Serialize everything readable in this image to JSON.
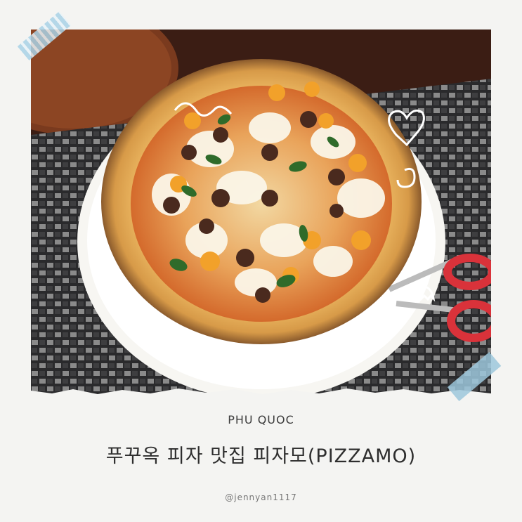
{
  "caption": {
    "location": "PHU QUOC",
    "title": "푸꾸옥 피자 맛집 피자모(PIZZAMO)",
    "handle": "@jennyan1117"
  },
  "decorations": {
    "tape_color": "#a3d9ee",
    "doodles": [
      "swirl-doodle",
      "heart-doodle",
      "spiral-doodle",
      "ghost-doodle"
    ]
  }
}
